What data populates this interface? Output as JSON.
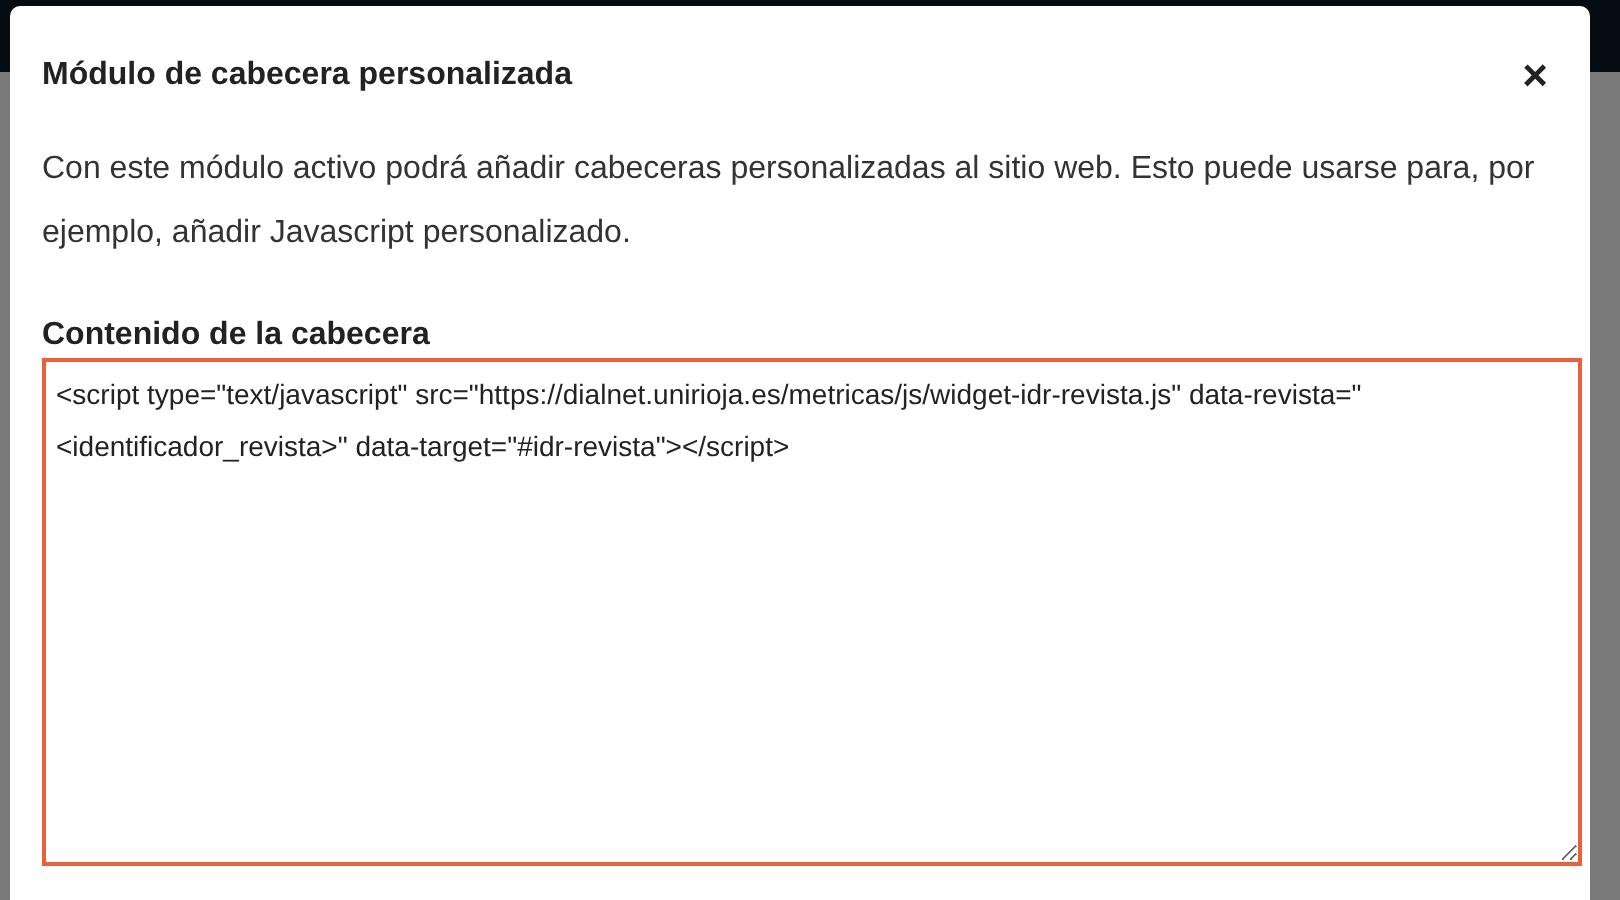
{
  "dialog": {
    "title": "Módulo de cabecera personalizada",
    "close": "×",
    "description": "Con este módulo activo podrá añadir cabeceras personalizadas al sitio web. Esto puede usarse para, por ejemplo, añadir Javascript personalizado.",
    "field": {
      "label": "Contenido de la cabecera",
      "value": "<script type=\"text/javascript\" src=\"https://dialnet.unirioja.es/metricas/js/widget-idr-revista.js\" data-revista=\"<identificador_revista>\" data-target=\"#idr-revista\"></script>",
      "focused": true
    }
  }
}
